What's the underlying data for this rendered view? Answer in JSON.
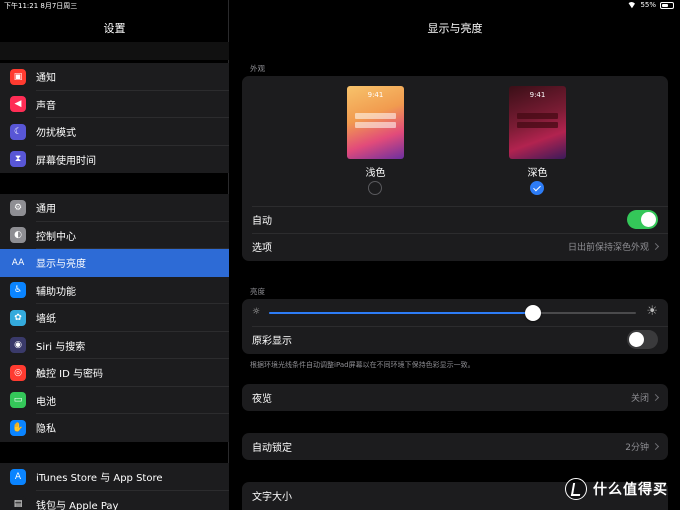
{
  "status": {
    "time_date": "下午11:21  8月7日周三",
    "battery": "55%",
    "battery_level": 0.55
  },
  "sidebar": {
    "title": "设置",
    "groups": [
      {
        "items": [
          {
            "label": "通知",
            "icon": "notifications-icon",
            "color": "#ff3b30",
            "glyph": "▣"
          },
          {
            "label": "声音",
            "icon": "sound-icon",
            "color": "#ff2d55",
            "glyph": "◀"
          },
          {
            "label": "勿扰模式",
            "icon": "moon-icon",
            "color": "#5856d6",
            "glyph": "☾"
          },
          {
            "label": "屏幕使用时间",
            "icon": "hourglass-icon",
            "color": "#5856d6",
            "glyph": "⧗"
          }
        ]
      },
      {
        "items": [
          {
            "label": "通用",
            "icon": "gear-icon",
            "color": "#8e8e93",
            "glyph": "⚙"
          },
          {
            "label": "控制中心",
            "icon": "toggles-icon",
            "color": "#8e8e93",
            "glyph": "◐"
          },
          {
            "label": "显示与亮度",
            "icon": "display-icon",
            "color": "#2d6bd6",
            "glyph": "AA",
            "active": true
          },
          {
            "label": "辅助功能",
            "icon": "accessibility-icon",
            "color": "#0a84ff",
            "glyph": "♿"
          },
          {
            "label": "墙纸",
            "icon": "wallpaper-icon",
            "color": "#34aadc",
            "glyph": "✿"
          },
          {
            "label": "Siri 与搜索",
            "icon": "siri-icon",
            "color": "#3a3a6a",
            "glyph": "◉"
          },
          {
            "label": "触控 ID 与密码",
            "icon": "fingerprint-icon",
            "color": "#ff3b30",
            "glyph": "◎"
          },
          {
            "label": "电池",
            "icon": "battery-icon",
            "color": "#34c759",
            "glyph": "▭"
          },
          {
            "label": "隐私",
            "icon": "hand-icon",
            "color": "#0a84ff",
            "glyph": "✋"
          }
        ]
      },
      {
        "items": [
          {
            "label": "iTunes Store 与 App Store",
            "icon": "app-store-icon",
            "color": "#0a84ff",
            "glyph": "A"
          },
          {
            "label": "钱包与 Apple Pay",
            "icon": "wallet-icon",
            "color": "#1c1c1e",
            "glyph": "▤"
          }
        ]
      }
    ]
  },
  "main": {
    "title": "显示与亮度",
    "appearance": {
      "section": "外观",
      "preview_time": "9:41",
      "light_label": "浅色",
      "dark_label": "深色",
      "selected": "dark",
      "auto_label": "自动",
      "auto_on": true,
      "options_label": "选项",
      "options_value": "日出前保持深色外观"
    },
    "brightness": {
      "section": "亮度",
      "level": 0.72,
      "truetone_label": "原彩显示",
      "truetone_on": false,
      "note": "根据环境光线条件自动调整iPad屏幕以在不同环境下保持色彩显示一致。"
    },
    "night_shift": {
      "label": "夜览",
      "value": "关闭"
    },
    "auto_lock": {
      "label": "自动锁定",
      "value": "2分钟"
    },
    "text_size": {
      "label": "文字大小"
    }
  },
  "watermark": {
    "text": "什么值得买"
  }
}
